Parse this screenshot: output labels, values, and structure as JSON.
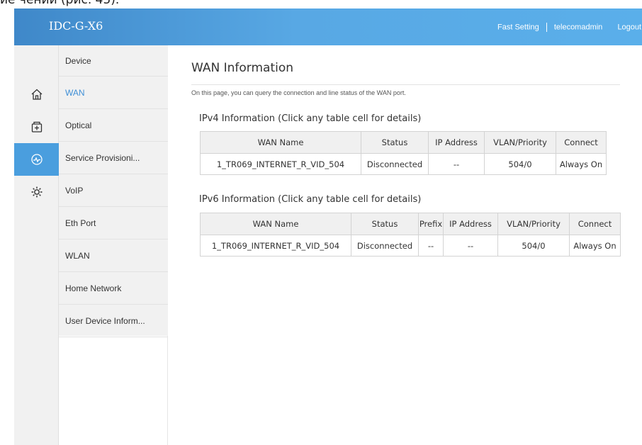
{
  "top_strip_text": "ие чении (рис. 45).",
  "header": {
    "logo": "IDC-G-X6",
    "links": [
      {
        "label": "Fast Setting"
      },
      {
        "label": "telecomadmin"
      },
      {
        "label": "Logout"
      }
    ]
  },
  "rail": [
    {
      "icon": "home-icon"
    },
    {
      "icon": "plus-box-icon"
    },
    {
      "icon": "pulse-circle-icon",
      "active": true
    },
    {
      "icon": "gear-icon"
    }
  ],
  "submenu": [
    {
      "label": "Device"
    },
    {
      "label": "WAN",
      "active": true
    },
    {
      "label": "Optical"
    },
    {
      "label": "Service Provisioni..."
    },
    {
      "label": "VoIP"
    },
    {
      "label": "Eth Port"
    },
    {
      "label": "WLAN"
    },
    {
      "label": "Home Network"
    },
    {
      "label": "User Device Inform..."
    }
  ],
  "main": {
    "title": "WAN Information",
    "description": "On this page, you can query the connection and line status of the WAN port.",
    "ipv4": {
      "title": "IPv4 Information (Click any table cell for details)",
      "columns": [
        "WAN Name",
        "Status",
        "IP Address",
        "VLAN/Priority",
        "Connect"
      ],
      "rows": [
        [
          "1_TR069_INTERNET_R_VID_504",
          "Disconnected",
          "--",
          "504/0",
          "Always On"
        ]
      ]
    },
    "ipv6": {
      "title": "IPv6 Information (Click any table cell for details)",
      "columns": [
        "WAN Name",
        "Status",
        "Prefix",
        "IP Address",
        "VLAN/Priority",
        "Connect"
      ],
      "rows": [
        [
          "1_TR069_INTERNET_R_VID_504",
          "Disconnected",
          "--",
          "--",
          "504/0",
          "Always On"
        ]
      ]
    }
  },
  "colors": {
    "header_start": "#3f88c9",
    "header_end": "#5aafea",
    "active_rail": "#4a9ede",
    "active_link": "#3f8fd6"
  }
}
